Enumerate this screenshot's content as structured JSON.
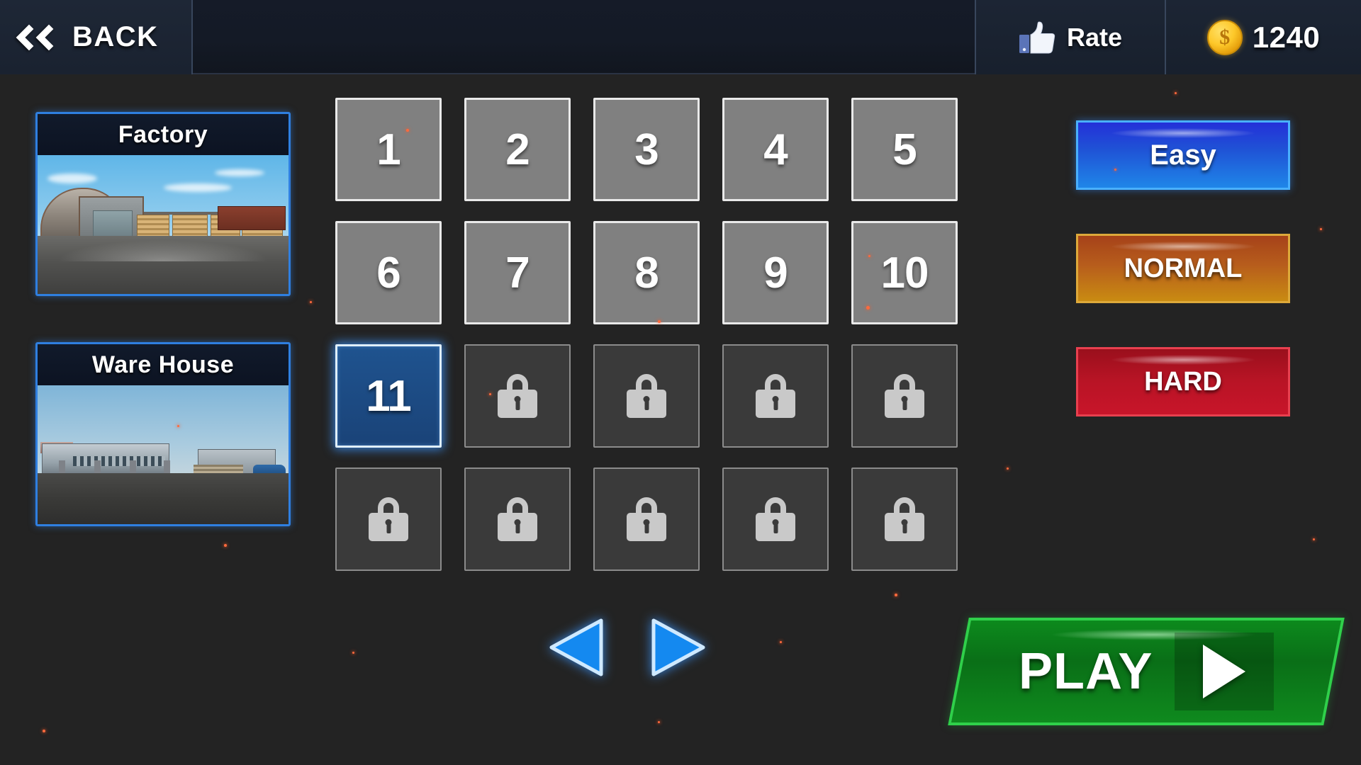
{
  "topbar": {
    "back_label": "BACK",
    "back_icon": "double-chevron-left-icon",
    "rate_label": "Rate",
    "rate_icon": "thumbs-up-icon",
    "coin_icon": "gold-coin-icon",
    "coin_value": "1240"
  },
  "maps": [
    {
      "title": "Factory",
      "selected": true
    },
    {
      "title": "Ware House",
      "selected": true
    }
  ],
  "levels": {
    "items": [
      {
        "label": "1",
        "state": "unlocked"
      },
      {
        "label": "2",
        "state": "unlocked"
      },
      {
        "label": "3",
        "state": "unlocked"
      },
      {
        "label": "4",
        "state": "unlocked"
      },
      {
        "label": "5",
        "state": "unlocked"
      },
      {
        "label": "6",
        "state": "unlocked"
      },
      {
        "label": "7",
        "state": "unlocked"
      },
      {
        "label": "8",
        "state": "unlocked"
      },
      {
        "label": "9",
        "state": "unlocked"
      },
      {
        "label": "10",
        "state": "unlocked"
      },
      {
        "label": "11",
        "state": "selected"
      },
      {
        "label": "",
        "state": "locked"
      },
      {
        "label": "",
        "state": "locked"
      },
      {
        "label": "",
        "state": "locked"
      },
      {
        "label": "",
        "state": "locked"
      },
      {
        "label": "",
        "state": "locked"
      },
      {
        "label": "",
        "state": "locked"
      },
      {
        "label": "",
        "state": "locked"
      },
      {
        "label": "",
        "state": "locked"
      },
      {
        "label": "",
        "state": "locked"
      }
    ],
    "lock_icon": "padlock-icon"
  },
  "pagination": {
    "prev_icon": "triangle-left-icon",
    "next_icon": "triangle-right-icon"
  },
  "difficulty": {
    "options": [
      {
        "label": "Easy",
        "selected": true
      },
      {
        "label": "NORMAL",
        "selected": false
      },
      {
        "label": "HARD",
        "selected": false
      }
    ]
  },
  "play": {
    "label": "PLAY",
    "icon": "play-triangle-icon"
  },
  "colors": {
    "background": "#232323",
    "topbar": "#141a26",
    "accent_blue": "#2f7fe0",
    "selected_level": "#1f538f",
    "easy": "#1f53d6",
    "normal": "#b75d1c",
    "hard": "#b81425",
    "play_green": "#0a6f17",
    "coin_gold": "#fdc82a",
    "locked_tile": "#3a3a3a",
    "unlocked_tile": "#808080"
  }
}
